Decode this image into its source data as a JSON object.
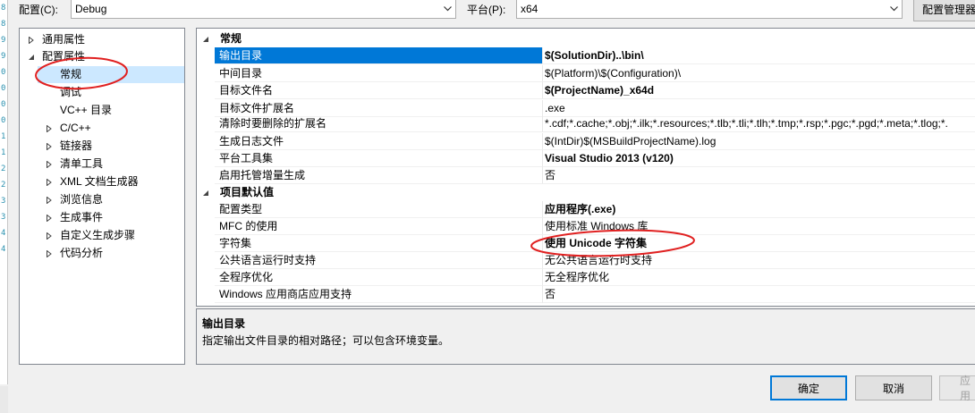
{
  "gutter": [
    "8",
    "8",
    "9",
    "9",
    "0",
    "0",
    "0",
    "0",
    "1",
    "1",
    "2",
    "2",
    "3",
    "3",
    "4",
    "4"
  ],
  "toolbar": {
    "config_label": "配置(C):",
    "config_value": "Debug",
    "platform_label": "平台(P):",
    "platform_value": "x64",
    "config_manager_label": "配置管理器"
  },
  "tree": {
    "common_props": "通用属性",
    "config_props": "配置属性",
    "items": [
      {
        "label": "常规",
        "expandable": false
      },
      {
        "label": "调试",
        "expandable": false
      },
      {
        "label": "VC++ 目录",
        "expandable": false
      },
      {
        "label": "C/C++",
        "expandable": true
      },
      {
        "label": "链接器",
        "expandable": true
      },
      {
        "label": "清单工具",
        "expandable": true
      },
      {
        "label": "XML 文档生成器",
        "expandable": true
      },
      {
        "label": "浏览信息",
        "expandable": true
      },
      {
        "label": "生成事件",
        "expandable": true
      },
      {
        "label": "自定义生成步骤",
        "expandable": true
      },
      {
        "label": "代码分析",
        "expandable": true
      }
    ]
  },
  "grid": {
    "categories": {
      "general": "常规",
      "project_defaults": "项目默认值"
    },
    "general_rows": [
      {
        "name": "输出目录",
        "value": "$(SolutionDir)..\\bin\\",
        "bold": true
      },
      {
        "name": "中间目录",
        "value": "$(Platform)\\$(Configuration)\\",
        "bold": false
      },
      {
        "name": "目标文件名",
        "value": "$(ProjectName)_x64d",
        "bold": true
      },
      {
        "name": "目标文件扩展名",
        "value": ".exe",
        "bold": false
      },
      {
        "name": "清除时要删除的扩展名",
        "value": "*.cdf;*.cache;*.obj;*.ilk;*.resources;*.tlb;*.tli;*.tlh;*.tmp;*.rsp;*.pgc;*.pgd;*.meta;*.tlog;*.",
        "bold": false
      },
      {
        "name": "生成日志文件",
        "value": "$(IntDir)$(MSBuildProjectName).log",
        "bold": false
      },
      {
        "name": "平台工具集",
        "value": "Visual Studio 2013 (v120)",
        "bold": true
      },
      {
        "name": "启用托管增量生成",
        "value": "否",
        "bold": false
      }
    ],
    "default_rows": [
      {
        "name": "配置类型",
        "value": "应用程序(.exe)",
        "bold": true
      },
      {
        "name": "MFC 的使用",
        "value": "使用标准 Windows 库",
        "bold": false
      },
      {
        "name": "字符集",
        "value": "使用 Unicode 字符集",
        "bold": true
      },
      {
        "name": "公共语言运行时支持",
        "value": "无公共语言运行时支持",
        "bold": false
      },
      {
        "name": "全程序优化",
        "value": "无全程序优化",
        "bold": false
      },
      {
        "name": "Windows 应用商店应用支持",
        "value": "否",
        "bold": false
      }
    ]
  },
  "description": {
    "title": "输出目录",
    "text": "指定输出文件目录的相对路径；可以包含环境变量。"
  },
  "buttons": {
    "ok": "确定",
    "cancel": "取消",
    "apply": "应用"
  },
  "colors": {
    "selection": "#0078d7",
    "tree_selection": "#cce8ff",
    "annotation": "#e02020"
  }
}
